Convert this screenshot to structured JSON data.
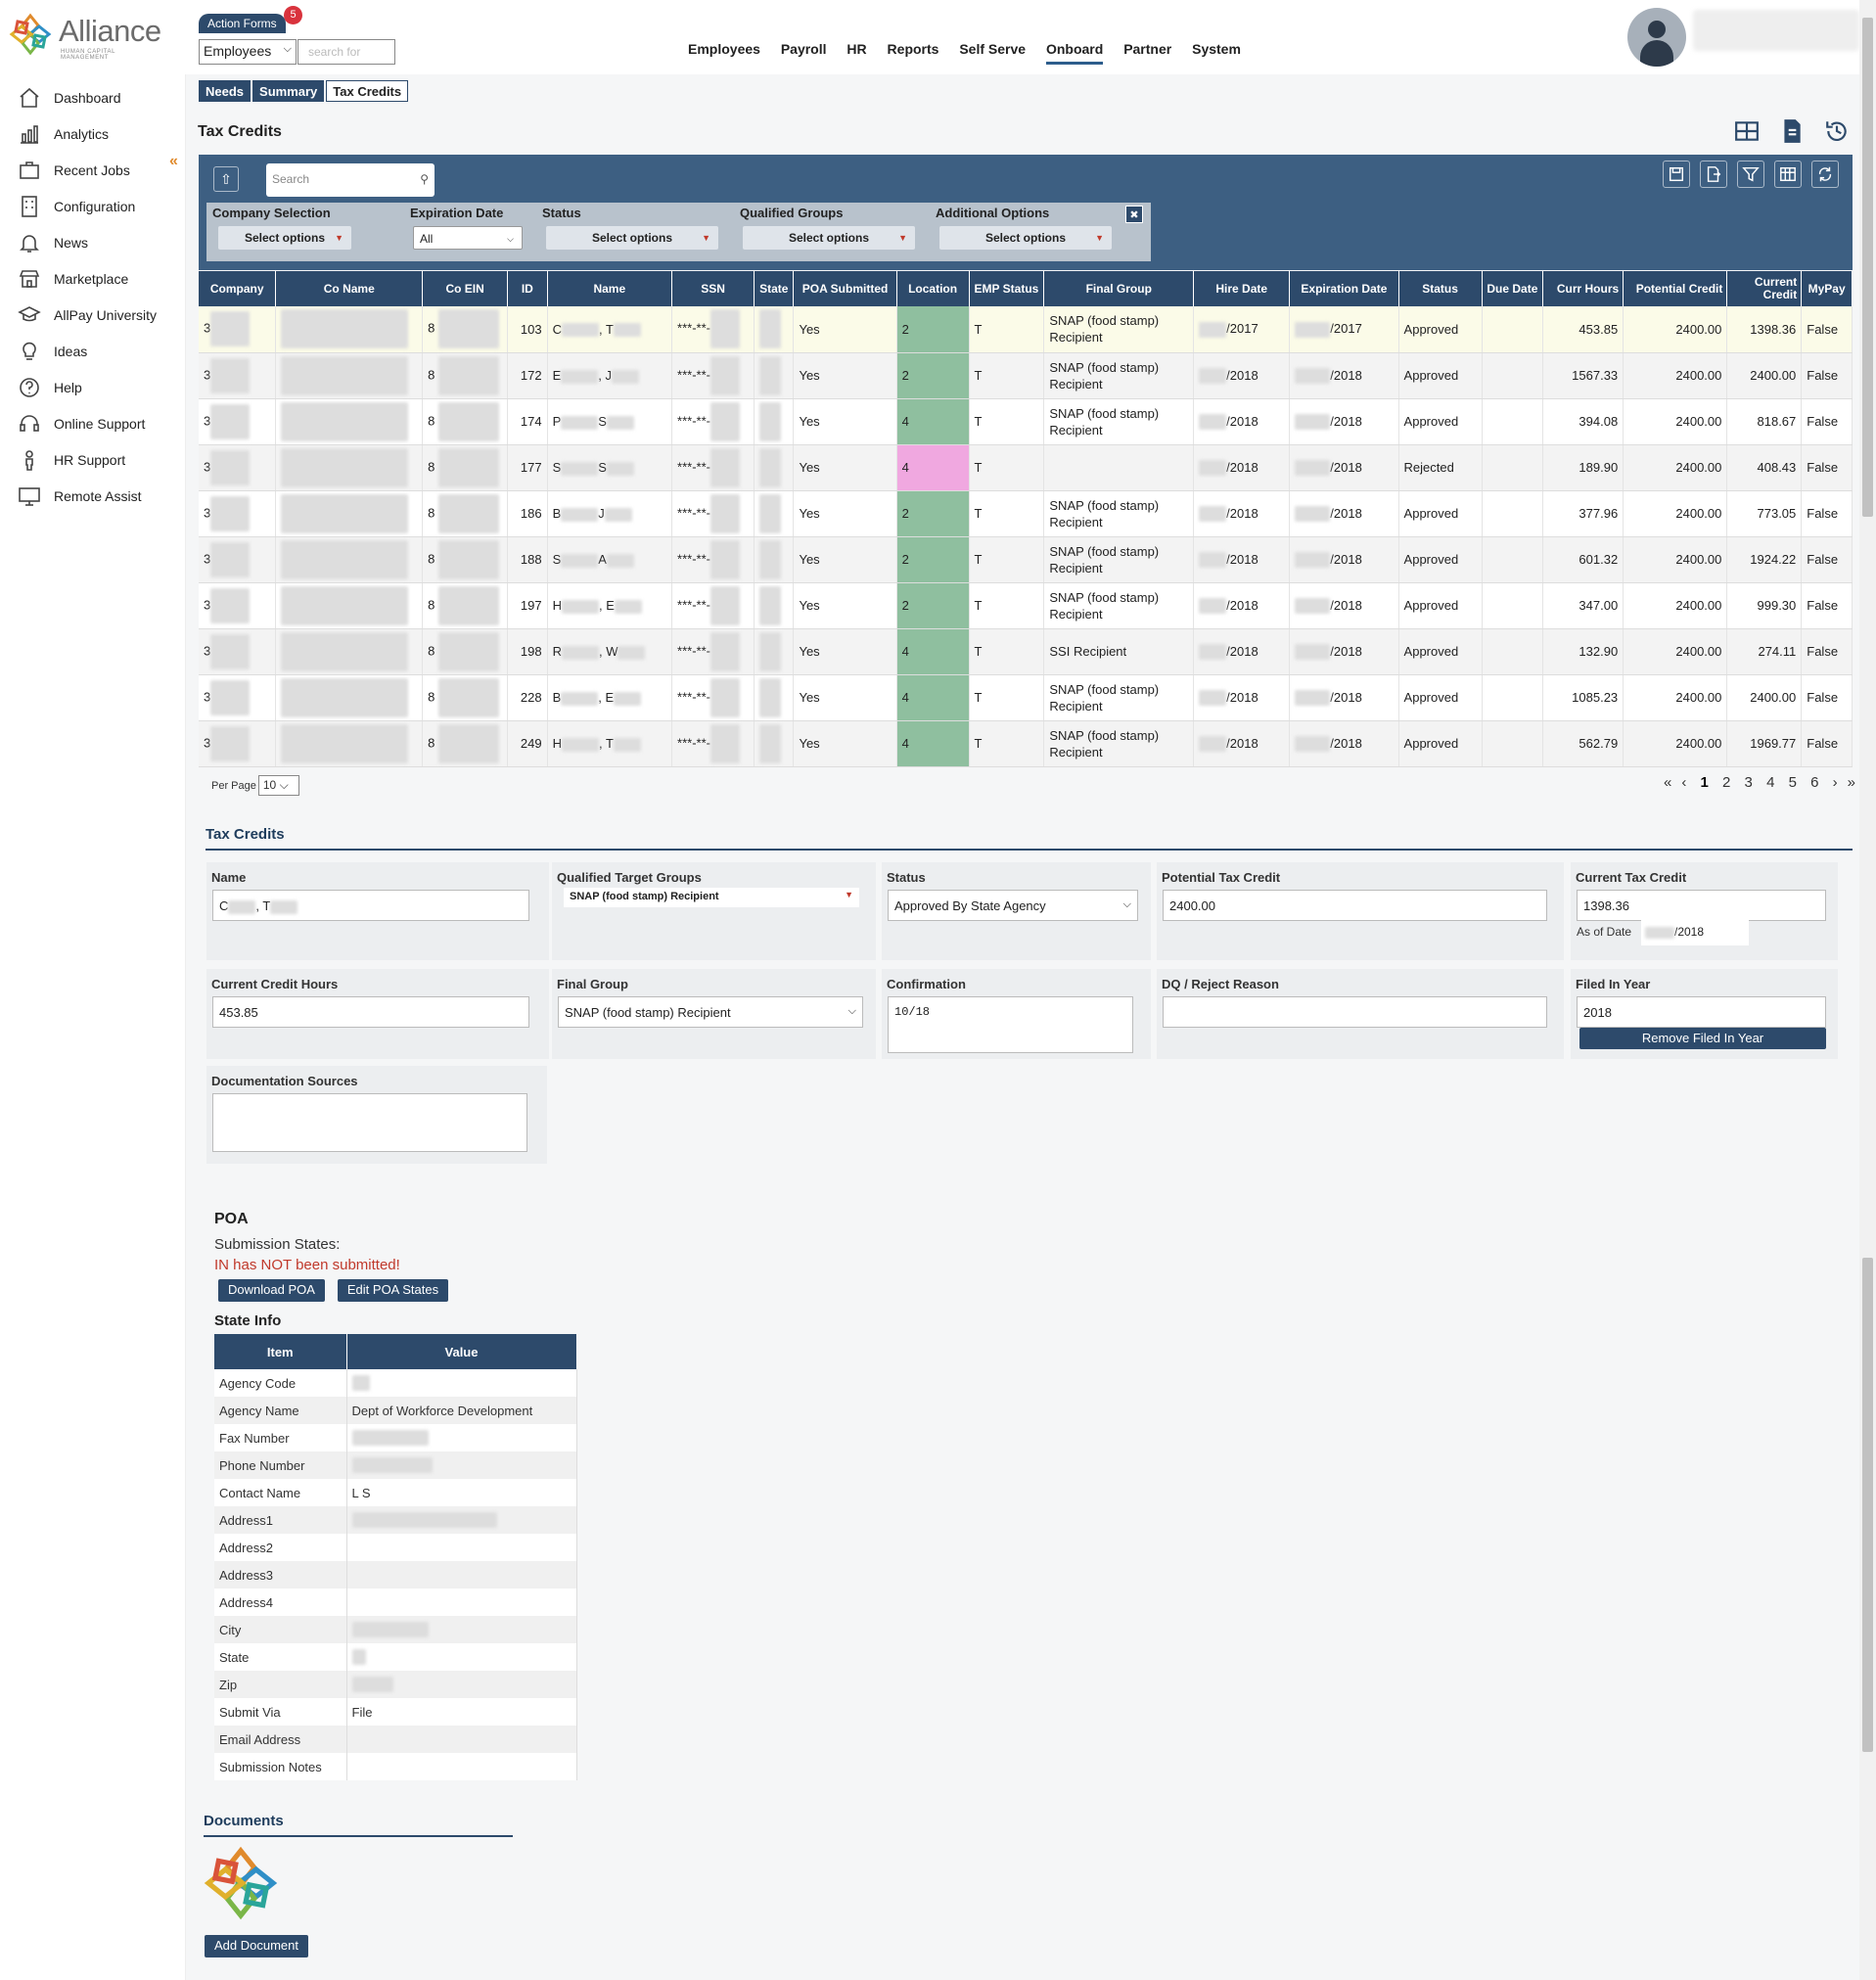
{
  "brand": {
    "name": "Alliance",
    "tagline": "HUMAN CAPITAL MANAGEMENT"
  },
  "header": {
    "action_forms": "Action Forms",
    "action_badge": "5",
    "employee_select": "Employees",
    "search_placeholder": "search for",
    "nav": [
      "Employees",
      "Payroll",
      "HR",
      "Reports",
      "Self Serve",
      "Onboard",
      "Partner",
      "System"
    ],
    "active_nav": "Onboard"
  },
  "sidebar": {
    "items": [
      {
        "label": "Dashboard",
        "icon": "home-icon"
      },
      {
        "label": "Analytics",
        "icon": "analytics-icon"
      },
      {
        "label": "Recent Jobs",
        "icon": "briefcase-icon"
      },
      {
        "label": "Configuration",
        "icon": "building-icon"
      },
      {
        "label": "News",
        "icon": "bell-icon"
      },
      {
        "label": "Marketplace",
        "icon": "store-icon"
      },
      {
        "label": "AllPay University",
        "icon": "graduation-cap-icon"
      },
      {
        "label": "Ideas",
        "icon": "lightbulb-icon"
      },
      {
        "label": "Help",
        "icon": "question-icon"
      },
      {
        "label": "Online Support",
        "icon": "headset-icon"
      },
      {
        "label": "HR Support",
        "icon": "person-icon"
      },
      {
        "label": "Remote Assist",
        "icon": "monitor-icon"
      }
    ]
  },
  "subtabs": [
    "Needs",
    "Summary",
    "Tax Credits"
  ],
  "page_title": "Tax Credits",
  "filters": {
    "search_placeholder": "Search",
    "company": {
      "label": "Company Selection",
      "value": "Select options"
    },
    "expiration": {
      "label": "Expiration Date",
      "value": "All"
    },
    "status": {
      "label": "Status",
      "value": "Select options"
    },
    "qualified": {
      "label": "Qualified Groups",
      "value": "Select options"
    },
    "additional": {
      "label": "Additional Options",
      "value": "Select options"
    }
  },
  "table": {
    "columns": [
      "Company",
      "Co Name",
      "Co EIN",
      "ID",
      "Name",
      "SSN",
      "State",
      "POA Submitted",
      "Location",
      "EMP Status",
      "Final Group",
      "Hire Date",
      "Expiration Date",
      "Status",
      "Due Date",
      "Curr Hours",
      "Potential Credit",
      "Current Credit",
      "MyPay"
    ],
    "rows": [
      {
        "company": "3",
        "ein": "8",
        "id": "103",
        "name_a": "C",
        "name_b": ", T",
        "ssn": "***-**-",
        "poa": "Yes",
        "loc": "2",
        "emp": "T",
        "group": "SNAP (food stamp) Recipient",
        "hire": "/2017",
        "exp": "/2017",
        "status": "Approved",
        "hours": "453.85",
        "potential": "2400.00",
        "current": "1398.36",
        "mypay": "False"
      },
      {
        "company": "3",
        "ein": "8",
        "id": "172",
        "name_a": "E",
        "name_b": ", J",
        "ssn": "***-**-",
        "poa": "Yes",
        "loc": "2",
        "emp": "T",
        "group": "SNAP (food stamp) Recipient",
        "hire": "/2018",
        "exp": "/2018",
        "status": "Approved",
        "hours": "1567.33",
        "potential": "2400.00",
        "current": "2400.00",
        "mypay": "False"
      },
      {
        "company": "3",
        "ein": "8",
        "id": "174",
        "name_a": "P",
        "name_b": "S",
        "ssn": "***-**-",
        "poa": "Yes",
        "loc": "4",
        "emp": "T",
        "group": "SNAP (food stamp) Recipient",
        "hire": "/2018",
        "exp": "/2018",
        "status": "Approved",
        "hours": "394.08",
        "potential": "2400.00",
        "current": "818.67",
        "mypay": "False"
      },
      {
        "company": "3",
        "ein": "8",
        "id": "177",
        "name_a": "S",
        "name_b": "S",
        "ssn": "***-**-",
        "poa": "Yes",
        "loc": "4",
        "emp": "T",
        "group": "",
        "hire": "/2018",
        "exp": "/2018",
        "status": "Rejected",
        "hours": "189.90",
        "potential": "2400.00",
        "current": "408.43",
        "mypay": "False"
      },
      {
        "company": "3",
        "ein": "8",
        "id": "186",
        "name_a": "B",
        "name_b": "J",
        "ssn": "***-**-",
        "poa": "Yes",
        "loc": "2",
        "emp": "T",
        "group": "SNAP (food stamp) Recipient",
        "hire": "/2018",
        "exp": "/2018",
        "status": "Approved",
        "hours": "377.96",
        "potential": "2400.00",
        "current": "773.05",
        "mypay": "False"
      },
      {
        "company": "3",
        "ein": "8",
        "id": "188",
        "name_a": "S",
        "name_b": "A",
        "ssn": "***-**-",
        "poa": "Yes",
        "loc": "2",
        "emp": "T",
        "group": "SNAP (food stamp) Recipient",
        "hire": "/2018",
        "exp": "/2018",
        "status": "Approved",
        "hours": "601.32",
        "potential": "2400.00",
        "current": "1924.22",
        "mypay": "False"
      },
      {
        "company": "3",
        "ein": "8",
        "id": "197",
        "name_a": "H",
        "name_b": ", E",
        "ssn": "***-**-",
        "poa": "Yes",
        "loc": "2",
        "emp": "T",
        "group": "SNAP (food stamp) Recipient",
        "hire": "/2018",
        "exp": "/2018",
        "status": "Approved",
        "hours": "347.00",
        "potential": "2400.00",
        "current": "999.30",
        "mypay": "False"
      },
      {
        "company": "3",
        "ein": "8",
        "id": "198",
        "name_a": "R",
        "name_b": ", W",
        "ssn": "***-**-",
        "poa": "Yes",
        "loc": "4",
        "emp": "T",
        "group": "SSI Recipient",
        "hire": "/2018",
        "exp": "/2018",
        "status": "Approved",
        "hours": "132.90",
        "potential": "2400.00",
        "current": "274.11",
        "mypay": "False"
      },
      {
        "company": "3",
        "ein": "8",
        "id": "228",
        "name_a": "B",
        "name_b": ", E",
        "ssn": "***-**-",
        "poa": "Yes",
        "loc": "4",
        "emp": "T",
        "group": "SNAP (food stamp) Recipient",
        "hire": "/2018",
        "exp": "/2018",
        "status": "Approved",
        "hours": "1085.23",
        "potential": "2400.00",
        "current": "2400.00",
        "mypay": "False"
      },
      {
        "company": "3",
        "ein": "8",
        "id": "249",
        "name_a": "H",
        "name_b": ", T",
        "ssn": "***-**-",
        "poa": "Yes",
        "loc": "4",
        "emp": "T",
        "group": "SNAP (food stamp) Recipient",
        "hire": "/2018",
        "exp": "/2018",
        "status": "Approved",
        "hours": "562.79",
        "potential": "2400.00",
        "current": "1969.77",
        "mypay": "False"
      }
    ]
  },
  "pagination": {
    "per_page_label": "Per Page",
    "per_page": "10",
    "pages": [
      "1",
      "2",
      "3",
      "4",
      "5",
      "6"
    ],
    "current": "1"
  },
  "detail": {
    "section_title": "Tax Credits",
    "name_label": "Name",
    "name_a": "C",
    "name_b": ", T",
    "qtg_label": "Qualified Target Groups",
    "qtg_value": "SNAP (food stamp) Recipient",
    "status_label": "Status",
    "status_value": "Approved By State Agency",
    "potential_label": "Potential Tax Credit",
    "potential_value": "2400.00",
    "current_label": "Current Tax Credit",
    "current_value": "1398.36",
    "as_of_label": "As of Date",
    "as_of_value": "/2018",
    "hours_label": "Current Credit Hours",
    "hours_value": "453.85",
    "final_group_label": "Final Group",
    "final_group_value": "SNAP (food stamp) Recipient",
    "confirmation_label": "Confirmation",
    "confirmation_value": "10/18",
    "dq_label": "DQ / Reject Reason",
    "dq_value": "",
    "filed_label": "Filed In Year",
    "filed_value": "2018",
    "remove_filed_btn": "Remove Filed In Year",
    "doc_sources_label": "Documentation Sources"
  },
  "poa": {
    "title": "POA",
    "submission_states": "Submission States:",
    "not_submitted": "IN has NOT been submitted!",
    "download_btn": "Download POA",
    "edit_btn": "Edit POA States"
  },
  "state_info": {
    "title": "State Info",
    "columns": [
      "Item",
      "Value"
    ],
    "rows": [
      {
        "item": "Agency Code",
        "value": ""
      },
      {
        "item": "Agency Name",
        "value": "Dept of Workforce Development"
      },
      {
        "item": "Fax Number",
        "value": ""
      },
      {
        "item": "Phone Number",
        "value": ""
      },
      {
        "item": "Contact Name",
        "value": "L  S"
      },
      {
        "item": "Address1",
        "value": ""
      },
      {
        "item": "Address2",
        "value": ""
      },
      {
        "item": "Address3",
        "value": ""
      },
      {
        "item": "Address4",
        "value": ""
      },
      {
        "item": "City",
        "value": ""
      },
      {
        "item": "State",
        "value": ""
      },
      {
        "item": "Zip",
        "value": ""
      },
      {
        "item": "Submit Via",
        "value": "File"
      },
      {
        "item": "Email Address",
        "value": ""
      },
      {
        "item": "Submission Notes",
        "value": ""
      }
    ]
  },
  "documents": {
    "title": "Documents",
    "add_btn": "Add Document"
  },
  "colors": {
    "primary": "#2d4a6b",
    "panel": "#3d5f82",
    "accent": "#e08a2c",
    "alert": "#c0392b",
    "location_green": "#8fbf9f",
    "location_pink": "#f0a8e0"
  }
}
